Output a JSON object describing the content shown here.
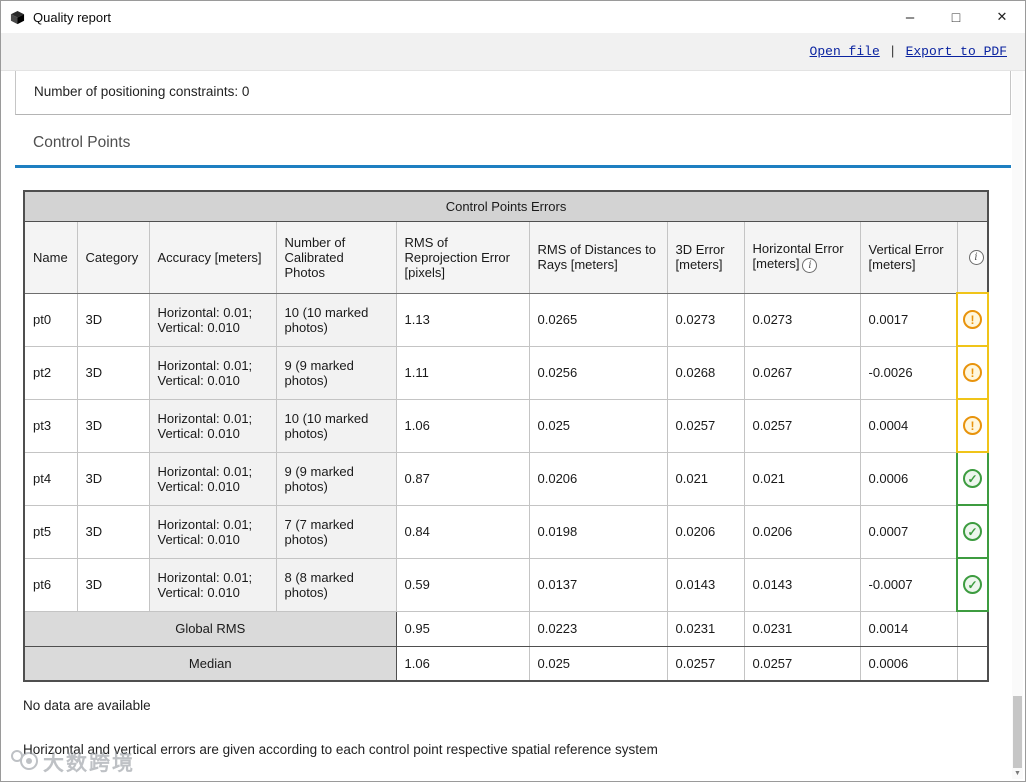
{
  "window": {
    "title": "Quality report"
  },
  "icons": {
    "minimize": "–",
    "maximize": "□",
    "close": "✕",
    "info": "i",
    "warning": "!",
    "ok": "✓",
    "scroll_down": "▼"
  },
  "linkbar": {
    "open_file": "Open file",
    "separator": "|",
    "export_pdf": "Export to PDF"
  },
  "report": {
    "constraints_line": "Number of positioning constraints: 0",
    "section_title": "Control Points",
    "no_data": "No data are available",
    "footnote": "Horizontal and vertical errors are given according to each control point respective spatial reference system"
  },
  "table": {
    "title": "Control Points Errors",
    "headers": {
      "name": "Name",
      "category": "Category",
      "accuracy": "Accuracy [meters]",
      "photos": "Number of Calibrated Photos",
      "rms_reprojection": "RMS of Reprojection Error [pixels]",
      "rms_distances": "RMS of Distances to Rays [meters]",
      "error3d": "3D Error [meters]",
      "horizontal_error": "Horizontal Error [meters]",
      "vertical_error": "Vertical Error [meters]"
    },
    "rows": [
      {
        "name": "pt0",
        "category": "3D",
        "accuracy": "Horizontal: 0.01; Vertical: 0.010",
        "photos": "10 (10 marked photos)",
        "rms_reprojection": "1.13",
        "rms_distances": "0.0265",
        "error3d": "0.0273",
        "horizontal_error": "0.0273",
        "vertical_error": "0.0017",
        "status": "warning"
      },
      {
        "name": "pt2",
        "category": "3D",
        "accuracy": "Horizontal: 0.01; Vertical: 0.010",
        "photos": "9 (9 marked photos)",
        "rms_reprojection": "1.11",
        "rms_distances": "0.0256",
        "error3d": "0.0268",
        "horizontal_error": "0.0267",
        "vertical_error": "-0.0026",
        "status": "warning"
      },
      {
        "name": "pt3",
        "category": "3D",
        "accuracy": "Horizontal: 0.01; Vertical: 0.010",
        "photos": "10 (10 marked photos)",
        "rms_reprojection": "1.06",
        "rms_distances": "0.025",
        "error3d": "0.0257",
        "horizontal_error": "0.0257",
        "vertical_error": "0.0004",
        "status": "warning"
      },
      {
        "name": "pt4",
        "category": "3D",
        "accuracy": "Horizontal: 0.01; Vertical: 0.010",
        "photos": "9 (9 marked photos)",
        "rms_reprojection": "0.87",
        "rms_distances": "0.0206",
        "error3d": "0.021",
        "horizontal_error": "0.021",
        "vertical_error": "0.0006",
        "status": "ok"
      },
      {
        "name": "pt5",
        "category": "3D",
        "accuracy": "Horizontal: 0.01; Vertical: 0.010",
        "photos": "7 (7 marked photos)",
        "rms_reprojection": "0.84",
        "rms_distances": "0.0198",
        "error3d": "0.0206",
        "horizontal_error": "0.0206",
        "vertical_error": "0.0007",
        "status": "ok"
      },
      {
        "name": "pt6",
        "category": "3D",
        "accuracy": "Horizontal: 0.01; Vertical: 0.010",
        "photos": "8 (8 marked photos)",
        "rms_reprojection": "0.59",
        "rms_distances": "0.0137",
        "error3d": "0.0143",
        "horizontal_error": "0.0143",
        "vertical_error": "-0.0007",
        "status": "ok"
      }
    ],
    "footer": [
      {
        "label": "Global RMS",
        "rms_reprojection": "0.95",
        "rms_distances": "0.0223",
        "error3d": "0.0231",
        "horizontal_error": "0.0231",
        "vertical_error": "0.0014"
      },
      {
        "label": "Median",
        "rms_reprojection": "1.06",
        "rms_distances": "0.025",
        "error3d": "0.0257",
        "horizontal_error": "0.0257",
        "vertical_error": "0.0006"
      }
    ]
  },
  "watermark": {
    "text": "大数跨境"
  },
  "colors": {
    "accent_blue": "#1e7fc1",
    "link_navy": "#0a23a0",
    "warning_orange": "#e8930c",
    "warning_border": "#f0c419",
    "ok_green": "#3d9c40",
    "table_title_bg": "#d3d3d3",
    "footer_label_bg": "#dadada"
  }
}
